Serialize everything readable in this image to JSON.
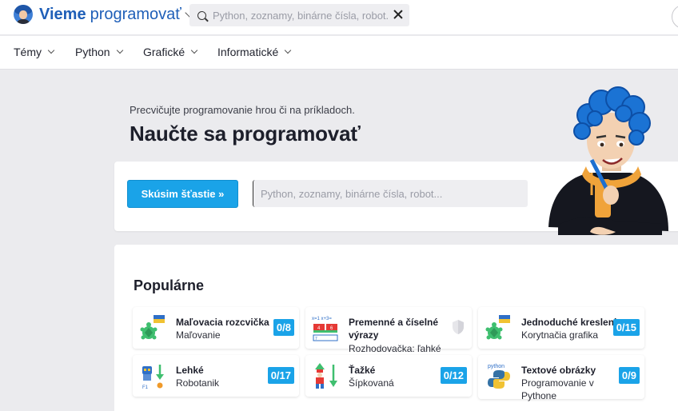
{
  "brand": {
    "bold": "Vieme",
    "light": "programovať"
  },
  "top_search": {
    "placeholder": "Python, zoznamy, binárne čísla, robot..."
  },
  "nav": [
    "Témy",
    "Python",
    "Grafické",
    "Informatické"
  ],
  "hero": {
    "subtitle": "Precvičujte programovanie hrou či na príkladoch.",
    "title": "Naučte sa programovať",
    "lucky_button": "Skúsim šťastie  »",
    "search_placeholder": "Python, zoznamy, binárne čísla, robot..."
  },
  "popular": {
    "heading": "Populárne",
    "tiles": [
      {
        "title": "Maľovacia rozcvička",
        "subtitle": "Maľovanie",
        "badge": "0/8",
        "icon": "turtle-paint-icon"
      },
      {
        "title": "Premenné a číselné výrazy",
        "subtitle": "Rozhodovačka: ľahké",
        "badge": "",
        "icon": "variables-icon"
      },
      {
        "title": "Jednoduché kreslenie",
        "subtitle": "Korytnačia grafika",
        "badge": "0/15",
        "icon": "turtle-graphics-icon"
      },
      {
        "title": "Lehké",
        "subtitle": "Robotanik",
        "badge": "0/17",
        "icon": "robot-icon"
      },
      {
        "title": "Ťažké",
        "subtitle": "Šípkovaná",
        "badge": "0/12",
        "icon": "arrow-game-icon"
      },
      {
        "title": "Textové obrázky",
        "subtitle": "Programovanie v Pythone",
        "badge": "0/9",
        "icon": "python-icon"
      }
    ]
  }
}
